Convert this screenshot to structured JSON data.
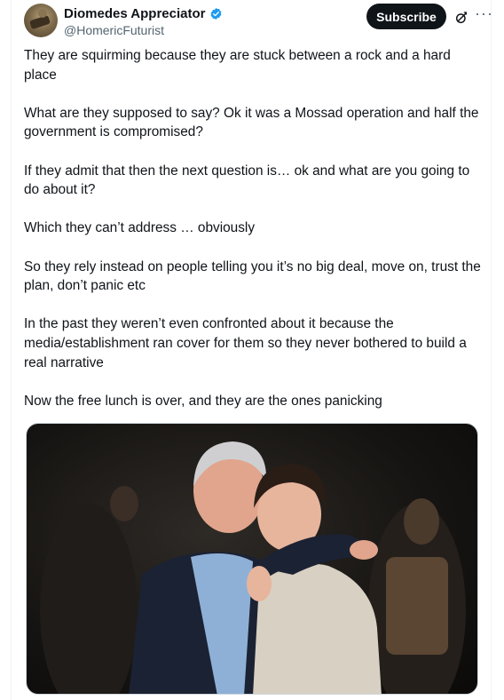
{
  "author": {
    "display_name": "Diomedes Appreciator",
    "handle": "@HomericFuturist",
    "avatar_icon": "avatar-image",
    "verified_icon": "verified-badge-icon",
    "verified_color": "#1d9bf0"
  },
  "actions": {
    "subscribe_label": "Subscribe",
    "grok_icon": "grok-icon",
    "more_label": "···"
  },
  "tweet": {
    "paragraphs": [
      "They are squirming because they are stuck between a rock and a hard place",
      "What are they supposed to say? Ok it was a Mossad operation and half the government is compromised?",
      "If they admit that then the next question is… ok and what are you going to do about it?",
      "Which they can’t address … obviously",
      "So they rely instead on people telling you it’s no big deal, move on, trust the plan, don’t panic etc",
      "In the past they weren’t even confronted about it because the media/establishment ran cover for them so they never bothered to build a real narrative",
      "Now the free lunch is over, and they are the ones panicking"
    ]
  },
  "colors": {
    "text_primary": "#0f1419",
    "text_secondary": "#536471",
    "button_bg": "#0f1419",
    "border": "#cfd9de"
  }
}
